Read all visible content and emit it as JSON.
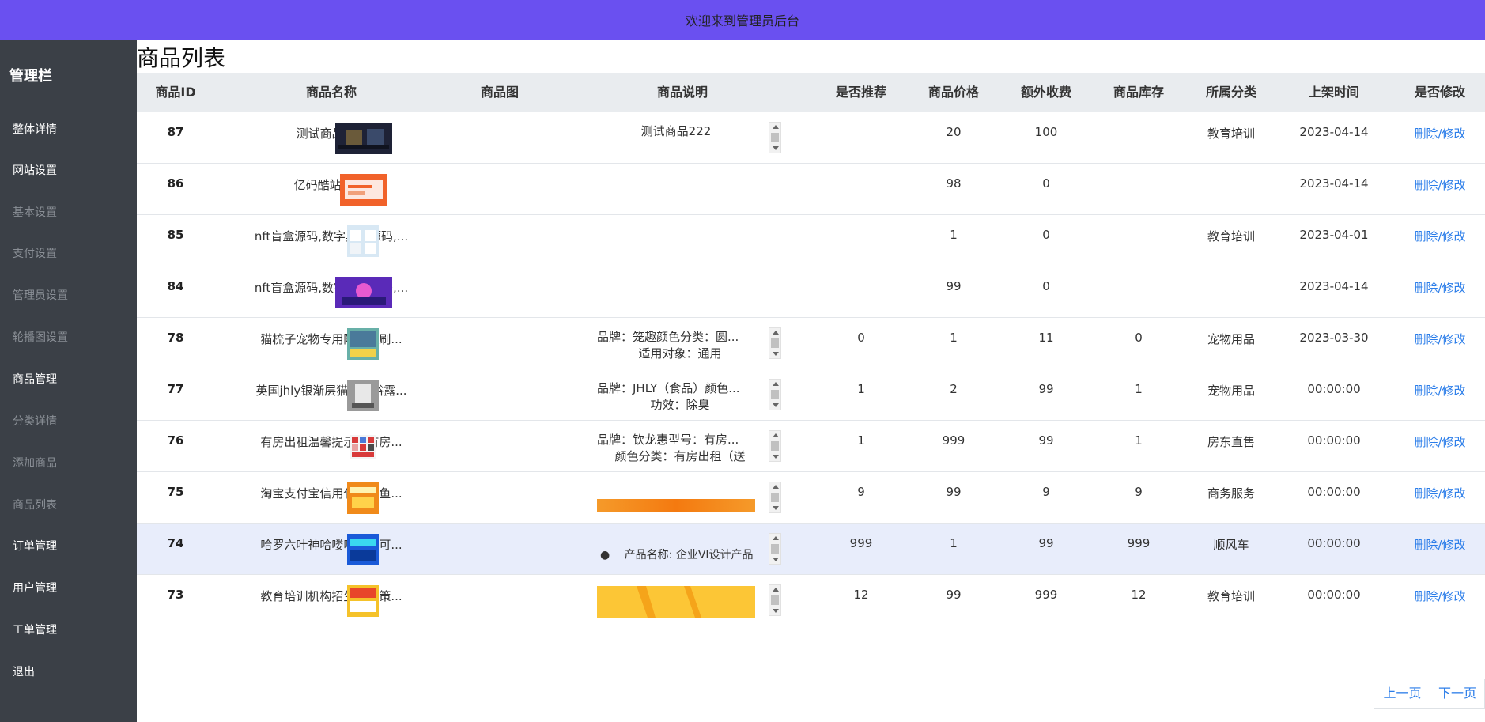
{
  "header": {
    "title": "欢迎来到管理员后台"
  },
  "sidebar": {
    "title": "管理栏",
    "items": [
      {
        "label": "整体详情",
        "bright": true
      },
      {
        "label": "网站设置",
        "bright": true
      },
      {
        "label": "基本设置",
        "bright": false
      },
      {
        "label": "支付设置",
        "bright": false
      },
      {
        "label": "管理员设置",
        "bright": false
      },
      {
        "label": "轮播图设置",
        "bright": false
      },
      {
        "label": "商品管理",
        "bright": true
      },
      {
        "label": "分类详情",
        "bright": false
      },
      {
        "label": "添加商品",
        "bright": false
      },
      {
        "label": "商品列表",
        "bright": false
      },
      {
        "label": "订单管理",
        "bright": true
      },
      {
        "label": "用户管理",
        "bright": true
      },
      {
        "label": "工单管理",
        "bright": true
      },
      {
        "label": "退出",
        "bright": true
      }
    ]
  },
  "main": {
    "title": "商品列表"
  },
  "table": {
    "columns": [
      "商品ID",
      "商品名称",
      "商品图",
      "商品说明",
      "是否推荐",
      "商品价格",
      "额外收费",
      "商品库存",
      "所属分类",
      "上架时间",
      "是否修改"
    ],
    "rows": [
      {
        "id": "87",
        "name": "测试商品222",
        "desc1": "测试商品222",
        "desc2": "",
        "recommend": "",
        "price": "20",
        "extra": "100",
        "stock": "",
        "category": "教育培训",
        "time": "2023-04-14",
        "action": "删除/修改",
        "thumb": "dark",
        "descScroll": true
      },
      {
        "id": "86",
        "name": "亿码酷站 演示",
        "desc1": "",
        "desc2": "",
        "recommend": "",
        "price": "98",
        "extra": "0",
        "stock": "",
        "category": "",
        "time": "2023-04-14",
        "action": "删除/修改",
        "thumb": "orange-ui",
        "descScroll": false
      },
      {
        "id": "85",
        "name": "nft盲盒源码,数字典藏源码,...",
        "desc1": "",
        "desc2": "",
        "recommend": "",
        "price": "1",
        "extra": "0",
        "stock": "",
        "category": "教育培训",
        "time": "2023-04-01",
        "action": "删除/修改",
        "thumb": "light",
        "descScroll": false
      },
      {
        "id": "84",
        "name": "nft盲盒源码,数字典藏源码,...",
        "desc1": "",
        "desc2": "",
        "recommend": "",
        "price": "99",
        "extra": "0",
        "stock": "",
        "category": "",
        "time": "2023-04-14",
        "action": "删除/修改",
        "thumb": "purple",
        "descScroll": false
      },
      {
        "id": "78",
        "name": "猫梳子宠物专用除浮毛刷...",
        "desc1": "品牌：笼趣颜色分类：圆...",
        "desc2": "适用对象：通用",
        "recommend": "0",
        "price": "1",
        "extra": "11",
        "stock": "0",
        "category": "宠物用品",
        "time": "2023-03-30",
        "action": "删除/修改",
        "thumb": "teal",
        "descScroll": true
      },
      {
        "id": "77",
        "name": "英国jhly银渐层猫咪沐浴露...",
        "desc1": "品牌：JHLY（食品）颜色...",
        "desc2": "功效：除臭",
        "recommend": "1",
        "price": "2",
        "extra": "99",
        "stock": "1",
        "category": "宠物用品",
        "time": "00:00:00",
        "action": "删除/修改",
        "thumb": "gray",
        "descScroll": true
      },
      {
        "id": "76",
        "name": "有房出租温馨提示牌有房...",
        "desc1": "品牌：钦龙惠型号：有房...",
        "desc2": "颜色分类：有房出租（送",
        "recommend": "1",
        "price": "999",
        "extra": "99",
        "stock": "1",
        "category": "房东直售",
        "time": "00:00:00",
        "action": "删除/修改",
        "thumb": "redgrid",
        "descScroll": true
      },
      {
        "id": "75",
        "name": "淘宝支付宝信用代拍闲鱼...",
        "desc1": "",
        "desc2": "",
        "recommend": "9",
        "price": "99",
        "extra": "9",
        "stock": "9",
        "category": "商务服务",
        "time": "00:00:00",
        "action": "删除/修改",
        "thumb": "orange",
        "descScroll": true,
        "descBanner": "orange"
      },
      {
        "id": "74",
        "name": "哈罗六叶神哈喽嘀嗒小可...",
        "desc1": "",
        "desc2": "产品名称: 企业VI设计产品",
        "recommend": "999",
        "price": "1",
        "extra": "99",
        "stock": "999",
        "category": "顺风车",
        "time": "00:00:00",
        "action": "删除/修改",
        "thumb": "blue",
        "descScroll": true,
        "bullet": true
      },
      {
        "id": "73",
        "name": "教育培训机构招生方案策...",
        "desc1": "",
        "desc2": "",
        "recommend": "12",
        "price": "99",
        "extra": "999",
        "stock": "12",
        "category": "教育培训",
        "time": "00:00:00",
        "action": "删除/修改",
        "thumb": "yellow",
        "descScroll": true,
        "descBanner": "yellow"
      }
    ]
  },
  "pager": {
    "prev": "上一页",
    "next": "下一页"
  },
  "colors": {
    "header": "#6a50f0",
    "sidebar": "#3b4047",
    "link": "#2b7de9",
    "highlight": "#e8edfb"
  }
}
